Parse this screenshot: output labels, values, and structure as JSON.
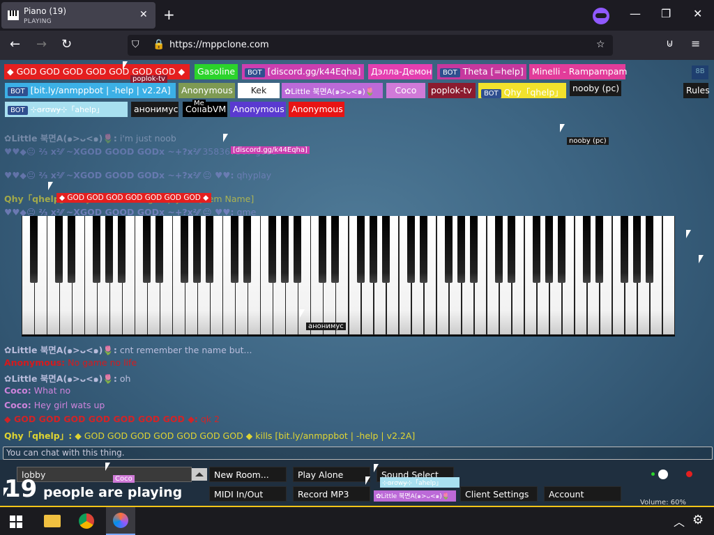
{
  "browser": {
    "tab_title": "Piano (19)",
    "tab_status": "PLAYING",
    "url_host": "https://mppclone.com"
  },
  "players": [
    {
      "name": "◆ GOD GOD GOD GOD GOD GOD GOD ◆",
      "bg": "#e41f1f",
      "color": "#fff"
    },
    {
      "name": "Gasoline",
      "bg": "#2bd42b",
      "color": "#fff"
    },
    {
      "name": "[discord.gg/k44Eqha]",
      "bg": "#cc3fb0",
      "color": "#fff",
      "bot": true
    },
    {
      "name": "Дэлла-Демон",
      "bg": "#e43fb0",
      "color": "#fff"
    },
    {
      "name": "Theta [=help]",
      "bg": "#c6389e",
      "color": "#fff",
      "bot": true
    },
    {
      "name": "Minelli - Rampampam",
      "bg": "#e23c9a",
      "color": "#fff"
    },
    {
      "name": "[bit.ly/anmppbot | -help | v2.2A]",
      "bg": "#3cb0e6",
      "color": "#fff",
      "bot": true
    },
    {
      "name": "Anonymous",
      "bg": "#7e9a53",
      "color": "#fff"
    },
    {
      "name": "Kek",
      "bg": "#ffffff",
      "color": "#222"
    },
    {
      "name": "✿Little 북면A(๑>ᴗ<๑)🌷",
      "bg": "#bc6ad8",
      "color": "#fff"
    },
    {
      "name": "Coco",
      "bg": "#d07ad8",
      "color": "#fff"
    },
    {
      "name": "poplok-tv",
      "bg": "#8b1b2f",
      "color": "#fff"
    },
    {
      "name": "Qhy「qhelp」",
      "bg": "#f2e22c",
      "color": "#222",
      "bot": true
    },
    {
      "name": "nooby (pc)",
      "bg": "#1a1a1a",
      "color": "#fff"
    },
    {
      "name": "⊹ɞɍσwɏ⊹「ahelp」",
      "bg": "#a8e0f0",
      "color": "#fff",
      "bot": true
    },
    {
      "name": "анонимус",
      "bg": "#1a1a1a",
      "color": "#fff"
    },
    {
      "name": "CollabVM",
      "bg": "#000000",
      "color": "#fff"
    },
    {
      "name": "Anonymous",
      "bg": "#5a3ad0",
      "color": "#fff"
    },
    {
      "name": "Anonymous",
      "bg": "#e81414",
      "color": "#fff"
    }
  ],
  "rules_label": "Rules",
  "top_right_badge": "8B",
  "chat": [
    {
      "name": "✿Little 북면A(๑>ᴗ<๑)🌷:",
      "name_color": "#c9c9e8",
      "text": "i'm just noob",
      "text_color": "#c9c9e8"
    },
    {
      "name": "♥♥◆😐 ⅔ x²⁄⁄ ~XGOD GOOD GODx ~+?x²⁄⁄",
      "name_color": "#8d8dd8",
      "text": "358367367 good",
      "text_color": "#8d8dd8"
    },
    {
      "name": "♥♥◆😐 ⅔ x²⁄⁄ ~XGOD GOOD GODx ~+?x²⁄⁄ 😐 ♥♥:",
      "name_color": "#8d8dd8",
      "text": "qhyplay",
      "text_color": "#8d8dd8"
    },
    {
      "name": "Qhy「qhelp」:",
      "name_color": "#f2e22c",
      "text": "... you want. Usage: qhyuse [Item Name]",
      "text_color": "#f2e22c"
    },
    {
      "name": "♥♥◆😐 ⅔ x²⁄⁄ ~XGOD GOOD GODx ~+?x²⁄⁄ 😐 ♥♥:",
      "name_color": "#8d8dd8",
      "text": "qme",
      "text_color": "#8d8dd8"
    },
    {
      "name": "✿Little 북면A(๑>ᴗ<๑)🌷:",
      "name_color": "#c9c9e8",
      "text": "cnt remember the name but...",
      "text_color": "#c9c9e8"
    },
    {
      "name": "Anonymous:",
      "name_color": "#e81414",
      "text": "No game no life",
      "text_color": "#e81414"
    },
    {
      "name": "✿Little 북면A(๑>ᴗ<๑)🌷:",
      "name_color": "#c9c9e8",
      "text": "oh",
      "text_color": "#c9c9e8"
    },
    {
      "name": "Coco:",
      "name_color": "#e08ae8",
      "text": "What no",
      "text_color": "#e08ae8"
    },
    {
      "name": "Coco:",
      "name_color": "#e08ae8",
      "text": "Hey girl wats up",
      "text_color": "#e08ae8"
    },
    {
      "name": "◆ GOD GOD GOD GOD GOD GOD GOD ◆:",
      "name_color": "#e41f1f",
      "text": "qk 2",
      "text_color": "#e41f1f"
    },
    {
      "name": "Qhy「qhelp」:",
      "name_color": "#f2e22c",
      "text": "◆ GOD GOD GOD GOD GOD GOD GOD ◆ kills [bit.ly/anmppbot | -help | v2.2A]",
      "text_color": "#f2e22c"
    }
  ],
  "cursor_labels": {
    "poplok": "poplok-tv",
    "discord": "[discord.gg/k44Eqha]",
    "god": "◆ GOD GOD GOD GOD GOD GOD GOD ◆",
    "nooby": "nooby (pc)",
    "me": "Me",
    "anon": "анонимус",
    "coco": "Coco",
    "ahelp": "⊹ɞɍσwɏ⊹「ahelp」",
    "little": "✿Little 북면A(๑>ᴗ<๑)🌷"
  },
  "chat_input": {
    "placeholder": "You can chat with this thing."
  },
  "room": {
    "value": "lobby"
  },
  "count": {
    "number": "19",
    "label": "people are playing"
  },
  "buttons": {
    "new_room": "New Room...",
    "play_alone": "Play Alone",
    "sound_select": "Sound Select",
    "midi": "MIDI In/Out",
    "record": "Record MP3",
    "client_settings": "Client Settings",
    "account": "Account"
  },
  "volume": {
    "label": "Volume: 60%",
    "value": 0.6
  },
  "colors": {
    "accent": "#f5c518"
  },
  "piano": {
    "white_keys": 52
  }
}
